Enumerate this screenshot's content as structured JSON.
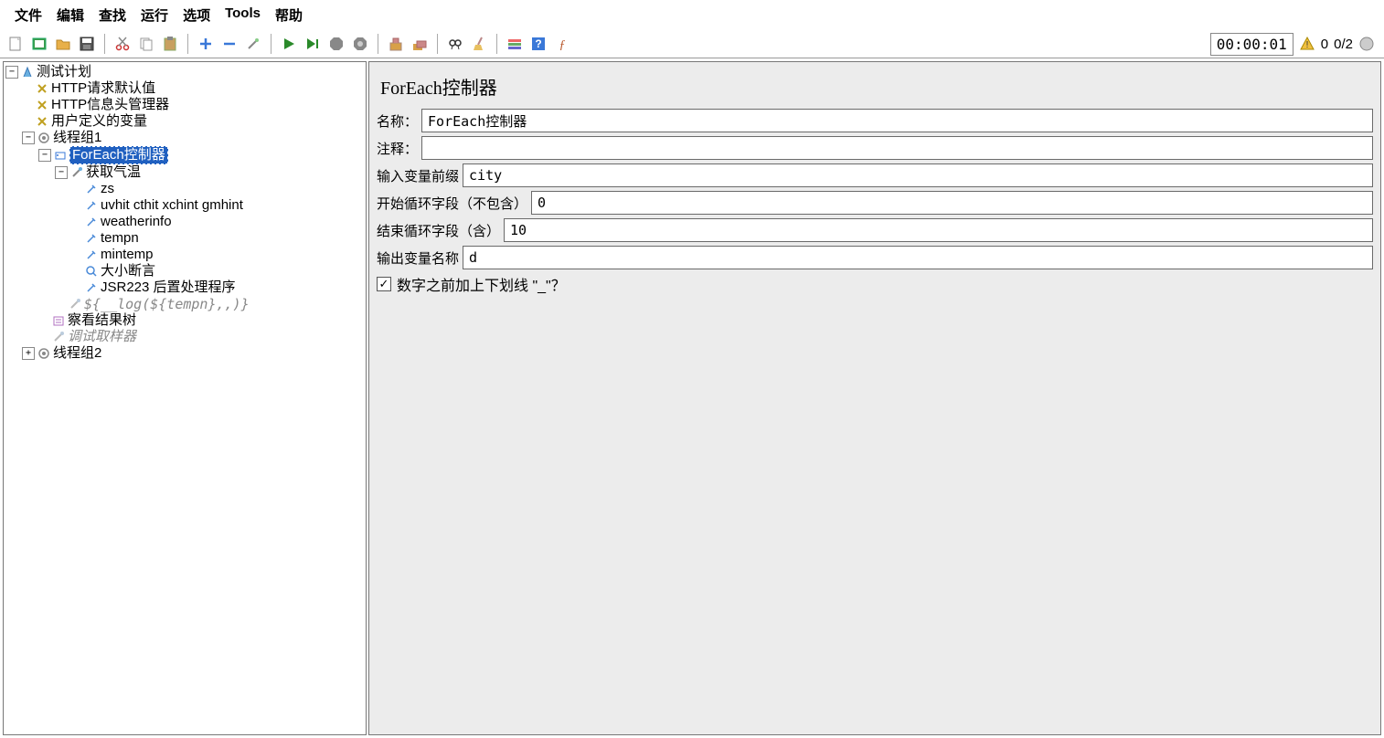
{
  "menu": [
    "文件",
    "编辑",
    "查找",
    "运行",
    "选项",
    "Tools",
    "帮助"
  ],
  "toolbar": {
    "icons": [
      "new-file",
      "templates-open",
      "folder-open",
      "save",
      "cut",
      "copy",
      "paste",
      "plus",
      "minus",
      "wand",
      "run",
      "run-next",
      "stop",
      "stop-all",
      "clear-stop",
      "clear-all",
      "search-binoculars",
      "broom",
      "toggle",
      "help",
      "function"
    ]
  },
  "status": {
    "timer": "00:00:01",
    "warn_count": "0",
    "ratio": "0/2"
  },
  "tree": {
    "root": "测试计划",
    "http_defaults": "HTTP请求默认值",
    "header_mgr": "HTTP信息头管理器",
    "user_vars": "用户定义的变量",
    "tg1": "线程组1",
    "foreach": "ForEach控制器",
    "weather": "获取气温",
    "v_zs": "zs",
    "v_uv": "uvhit cthit xchint gmhint",
    "v_wi": "weatherinfo",
    "v_tn": "tempn",
    "v_mt": "mintemp",
    "assert": "大小断言",
    "jsr": "JSR223 后置处理程序",
    "log_expr": "${__log(${tempn},,)}",
    "results": "察看结果树",
    "debug": "调试取样器",
    "tg2": "线程组2"
  },
  "form": {
    "title": "ForEach控制器",
    "name_label": "名称：",
    "name_value": "ForEach控制器",
    "comment_label": "注释：",
    "comment_value": "",
    "input_prefix_label": "输入变量前缀",
    "input_prefix_value": "city",
    "start_label": "开始循环字段（不包含）",
    "start_value": "0",
    "end_label": "结束循环字段（含）",
    "end_value": "10",
    "output_label": "输出变量名称",
    "output_value": "d",
    "underscore_label": "数字之前加上下划线 \"_\"？",
    "underscore_checked": true
  }
}
